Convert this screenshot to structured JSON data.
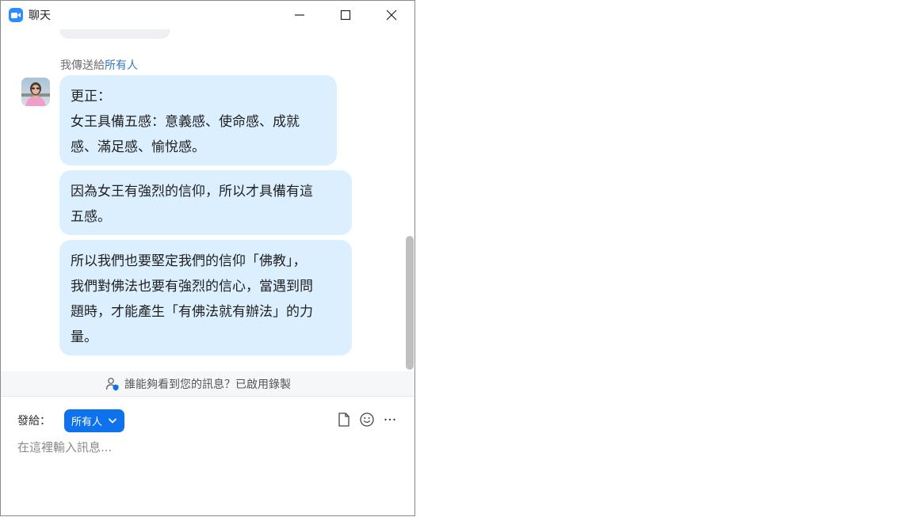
{
  "window": {
    "title": "聊天"
  },
  "chat": {
    "sender_prefix": "我傳送給",
    "recipient": "所有人",
    "messages": [
      {
        "lines": [
          "更正：",
          "女王具備五感：意義感、使命感、成就",
          "感、滿足感、愉悅感。"
        ]
      },
      {
        "lines": [
          "因為女王有強烈的信仰，所以才具備有這",
          "五感。"
        ]
      },
      {
        "lines": [
          "所以我們也要堅定我們的信仰「佛教」，",
          "我們對佛法也要有強烈的信心，當遇到問",
          "題時，才能產生「有佛法就有辦法」的力",
          "量。"
        ]
      }
    ]
  },
  "notice": {
    "text": "誰能夠看到您的訊息？已啟用錄製"
  },
  "composer": {
    "send_to_label": "發給：",
    "recipient_button": "所有人",
    "input_value": "",
    "input_placeholder": "在這裡輸入訊息..."
  },
  "colors": {
    "accent": "#0e72ed",
    "bubble": "#dcefff",
    "recipient_link": "#2f78c4"
  },
  "icons": [
    "zoom-app-icon",
    "minimize-icon",
    "maximize-icon",
    "close-icon",
    "privacy-shield-user-icon",
    "chevron-down-icon",
    "file-icon",
    "emoji-icon",
    "more-icon"
  ]
}
